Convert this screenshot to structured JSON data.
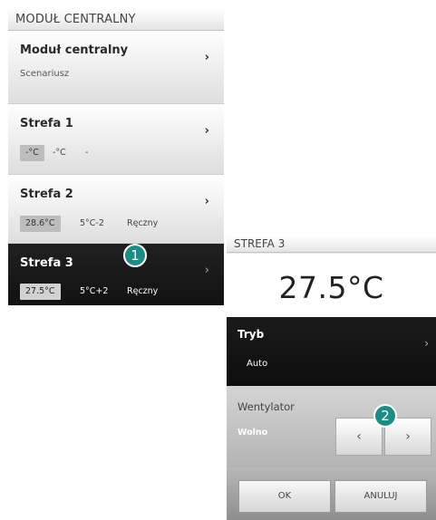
{
  "central_panel": {
    "title": "MODUŁ CENTRALNY",
    "central_module": {
      "name": "Moduł centralny",
      "subtitle": "Scenariusz"
    },
    "zones": [
      {
        "name": "Strefa 1",
        "temperature": "-°C",
        "setpoint": "-°C",
        "mode": "-"
      },
      {
        "name": "Strefa 2",
        "temperature": "28.6°C",
        "setpoint": "5°C-2",
        "mode": "Ręczny"
      },
      {
        "name": "Strefa 3",
        "temperature": "27.5°C",
        "setpoint": "5°C+2",
        "mode": "Ręczny",
        "selected": true
      }
    ]
  },
  "callouts": [
    "1",
    "2"
  ],
  "zone_detail": {
    "title": "STREFA 3",
    "temperature": "27.5°C",
    "mode": {
      "label": "Tryb",
      "value": "Auto"
    },
    "fan": {
      "label": "Wentylator",
      "value": "Wolno"
    },
    "buttons": {
      "prev": "‹",
      "next": "›",
      "ok": "OK",
      "cancel": "ANULUJ"
    }
  },
  "icons": {
    "chevron": "chevron-right-icon"
  },
  "colors": {
    "callout": "#1e8c84",
    "selected_row": "#1a1a1a",
    "temp_box": "#bdbdbd"
  }
}
